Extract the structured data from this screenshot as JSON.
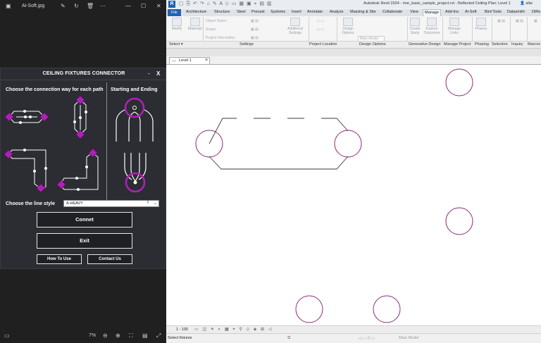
{
  "viewer": {
    "filename": "Ai-Soft.jpg",
    "zoom": "7%",
    "icons": [
      "image-icon",
      "edit-icon",
      "rotate-icon",
      "delete-icon",
      "more-icon",
      "minimize-icon",
      "maximize-icon",
      "close-icon"
    ]
  },
  "dialog": {
    "title": "CEILING FIXTURES CONNECTOR",
    "minimize": "-",
    "close": "X",
    "choose_heading": "Choose the connection way for each path",
    "starting_heading": "Starting and Ending",
    "line_style_label": "Choose the line style",
    "line_style_value": "A-HEAVY",
    "connect_label": "Connet",
    "exit_label": "Exit",
    "howto_label": "How To Use",
    "contact_label": "Contact Us",
    "accent_color": "#b21fb8"
  },
  "revit": {
    "logo": "R",
    "title": "Autodesk Revit 2024 - rme_basic_sample_project.rvt - Reflected Ceiling Plan: Level 1",
    "user": "aliw",
    "tabs": [
      "File",
      "Architecture",
      "Structure",
      "Steel",
      "Precast",
      "Systems",
      "Insert",
      "Annotate",
      "Analyze",
      "Massing & Site",
      "Collaborate",
      "View",
      "Manage",
      "Add-Ins",
      "Ai-Soft",
      "Bird Tools",
      "Datasmith",
      "DiRo"
    ],
    "active_tab": "Manage",
    "ribbon": {
      "modify": "Modify",
      "materials": "Materials",
      "object_styles": "Object Styles",
      "snaps": "Snaps",
      "project_information": "Project Information",
      "additional_settings": "Additional Settings",
      "design_options": "Design Options",
      "main_model": "Main Model",
      "create_study": "Create Study",
      "explore_outcomes": "Explore Outcomes",
      "manage_links": "Manage Links",
      "phases": "Phases"
    },
    "panels": [
      "Select",
      "Settings",
      "Project Location",
      "Design Options",
      "Generative Design",
      "Manage Project",
      "Phasing",
      "Selection",
      "Inquiry",
      "Macros"
    ],
    "view_tab": "Level 1",
    "view_tab_close": "×",
    "scale": "1 : 100",
    "status_text": "Select fixtures",
    "workset": "Main Model",
    "line_color": "#8e2a7e"
  }
}
